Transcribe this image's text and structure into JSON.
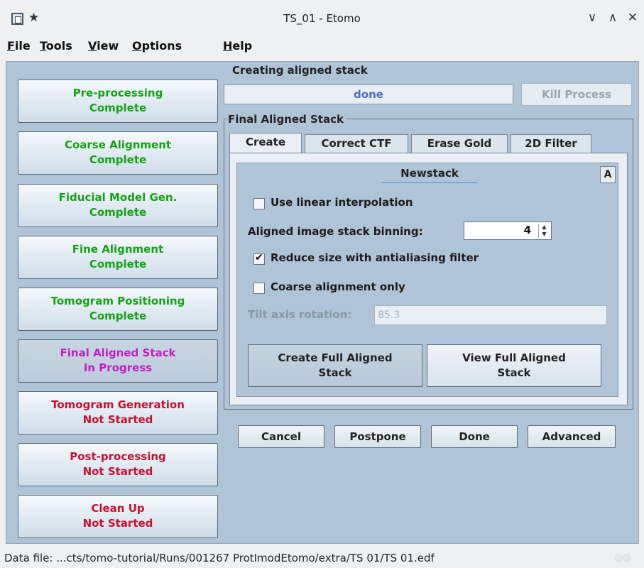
{
  "window": {
    "title": "TS_01 - Etomo",
    "minimize_glyph": "∨",
    "maximize_glyph": "∧",
    "close_glyph": "✕"
  },
  "menubar": {
    "items": [
      {
        "first": "F",
        "rest": "ile"
      },
      {
        "first": "T",
        "rest": "ools"
      },
      {
        "first": "V",
        "rest": "iew"
      },
      {
        "first": "O",
        "rest": "ptions"
      },
      {
        "first": "H",
        "rest": "elp"
      }
    ]
  },
  "steps": [
    {
      "name": "Pre-processing",
      "status": "Complete",
      "color": "#14a314"
    },
    {
      "name": "Coarse Alignment",
      "status": "Complete",
      "color": "#14a314"
    },
    {
      "name": "Fiducial Model Gen.",
      "status": "Complete",
      "color": "#14a314"
    },
    {
      "name": "Fine Alignment",
      "status": "Complete",
      "color": "#14a314"
    },
    {
      "name": "Tomogram Positioning",
      "status": "Complete",
      "color": "#14a314"
    },
    {
      "name": "Final Aligned Stack",
      "status": "In Progress",
      "color": "#c21ec2"
    },
    {
      "name": "Tomogram Generation",
      "status": "Not Started",
      "color": "#c8102e"
    },
    {
      "name": "Post-processing",
      "status": "Not Started",
      "color": "#c8102e"
    },
    {
      "name": "Clean Up",
      "status": "Not Started",
      "color": "#c8102e"
    }
  ],
  "process": {
    "title": "Creating aligned stack",
    "progress_text": "done",
    "kill_label": "Kill Process"
  },
  "panel": {
    "group_title": "Final Aligned Stack",
    "tabs": [
      "Create",
      "Correct CTF",
      "Erase Gold",
      "2D Filter"
    ],
    "selected_tab": "Create",
    "section_title": "Newstack",
    "advanced_toggle": "A",
    "use_linear_interpolation": {
      "label": "Use linear interpolation",
      "checked": false
    },
    "binning": {
      "label": "Aligned image stack binning:",
      "value": "4"
    },
    "antialias": {
      "label": "Reduce size with antialiasing filter",
      "checked": true
    },
    "coarse_only": {
      "label": "Coarse alignment only",
      "checked": false
    },
    "tilt_axis": {
      "label": "Tilt axis rotation:",
      "value": "85.3"
    },
    "create_btn": {
      "line1": "Create Full Aligned",
      "line2": "Stack"
    },
    "view_btn": {
      "line1": "View Full Aligned",
      "line2": "Stack"
    }
  },
  "footer_buttons": {
    "cancel": "Cancel",
    "postpone": "Postpone",
    "done": "Done",
    "advanced": "Advanced"
  },
  "statusbar": {
    "text": "Data file: ...cts/tomo-tutorial/Runs/001267 ProtImodEtomo/extra/TS 01/TS 01.edf"
  }
}
